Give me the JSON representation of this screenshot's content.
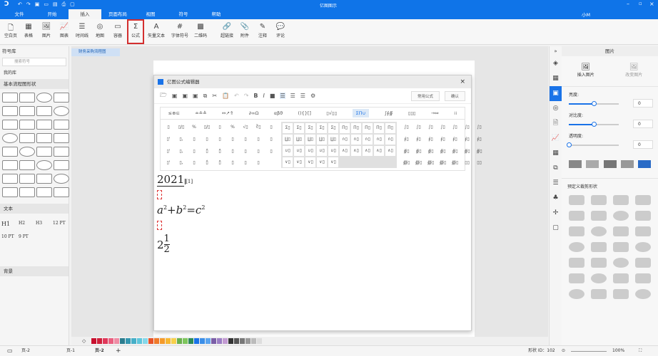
{
  "app": {
    "title": "亿图图示",
    "user": "小M"
  },
  "menu": [
    "文件",
    "开始",
    "插入",
    "页面布局",
    "视图",
    "符号",
    "帮助"
  ],
  "ribbon": [
    {
      "label": "空白页",
      "icon": "🗋"
    },
    {
      "label": "表格",
      "icon": "▦"
    },
    {
      "label": "图片",
      "icon": "🖼"
    },
    {
      "label": "图表",
      "icon": "📈"
    },
    {
      "label": "时间线",
      "icon": "☰"
    },
    {
      "label": "地图",
      "icon": "◎"
    },
    {
      "label": "容器",
      "icon": "▭"
    },
    {
      "label": "公式",
      "icon": "Σ"
    },
    {
      "label": "矢量文本",
      "icon": "A"
    },
    {
      "label": "字体符号",
      "icon": "#"
    },
    {
      "label": "二维码",
      "icon": "▩"
    },
    {
      "label": "超链接",
      "icon": "🔗"
    },
    {
      "label": "附件",
      "icon": "📎"
    },
    {
      "label": "注释",
      "icon": "✎"
    },
    {
      "label": "评论",
      "icon": "💬"
    }
  ],
  "left": {
    "title": "符号库",
    "search_placeholder": "搜索符号",
    "my_lib": "我的库",
    "basic": "基本流程图形状",
    "text_section": "文本",
    "text_items": [
      "H1",
      "H2",
      "H3",
      "12 PT",
      "10 PT",
      "9 PT"
    ],
    "bg_section": "背景"
  },
  "doc_tab": "财务采购流程图",
  "dialog": {
    "title": "亿图公式编辑器",
    "common": "常用公式",
    "confirm": "确认",
    "tabs": [
      "≤⊕⊆",
      "≐≗≙",
      "↔↗⇑",
      "∂∞Ω",
      "αβϑ",
      "(){}[]",
      "▯√▯▯",
      "ΣΠ∪",
      "∫∮∯",
      "▯▯▯",
      "→⇔",
      "⁞⁞"
    ],
    "active_tab": "ΣΠ∪",
    "left_syms": [
      "▯",
      "▯/▯",
      "%",
      "▯/▯",
      "▯",
      "%",
      "√▯",
      "∛▯",
      "▯",
      "▯'",
      "▯,",
      "▯",
      "▯",
      "▯",
      "▯",
      "▯",
      "▯",
      "▯",
      "▯'",
      "▯,",
      "▯",
      "▯̂",
      "▯̆",
      "▯̇",
      "▯",
      "▯",
      "▯",
      "▯'",
      "▯,",
      "▯",
      "▯̂",
      "▯̆",
      "▯̇",
      "▯",
      "▯"
    ],
    "mid_syms": [
      "Σ▯",
      "Σ▯",
      "Σ▯",
      "Σ▯",
      "Σ▯",
      "Π▯",
      "Π▯",
      "Π▯",
      "Π▯",
      "Π▯",
      "∐▯",
      "∐▯",
      "∐▯",
      "∐▯",
      "∐▯",
      "∩▯",
      "∩▯",
      "∩▯",
      "∩▯",
      "∩▯",
      "∪▯",
      "∪▯",
      "∪▯",
      "∪▯",
      "∪▯",
      "∧▯",
      "∧▯",
      "∧▯",
      "∧▯",
      "∧▯",
      "∨▯",
      "∨▯",
      "∨▯",
      "∨▯",
      "∨▯"
    ],
    "right_syms": [
      "∫▯",
      "∫▯",
      "∫▯",
      "∫▯",
      "∫▯",
      "∫▯",
      "∫▯",
      "∮▯",
      "∮▯",
      "∮▯",
      "∮▯",
      "∮▯",
      "∮▯",
      "∮▯",
      "∯▯",
      "∯▯",
      "∯▯",
      "∯▯",
      "∯▯",
      "∯▯",
      "∯▯",
      "∰▯",
      "∰▯",
      "∰▯",
      "∰▯",
      "∰▯",
      "▯▯",
      "▯▯"
    ],
    "formula1": "2021",
    "formula1_sub": "[1]",
    "formula3": {
      "a": "a",
      "b": "b",
      "c": "c",
      "exp": "2"
    },
    "formula5": {
      "whole": "2",
      "num": "1",
      "den": "2"
    }
  },
  "right": {
    "title": "图片",
    "insert": "插入图片",
    "change": "改变图片",
    "brightness": "亮度:",
    "contrast": "对比度:",
    "transparency": "透明度:",
    "brightness_val": "0",
    "contrast_val": "0",
    "transparency_val": "0",
    "brightness_level": 50,
    "contrast_level": 50,
    "transparency_level": 0,
    "crop_title": "预定义裁剪形状"
  },
  "status": {
    "page_select": "页-2",
    "pages": [
      "页-1",
      "页-2"
    ],
    "add": "+",
    "shape_id": "形状 ID：102",
    "zoom": "100%"
  },
  "palette": [
    "#c8102e",
    "#d0213b",
    "#e0385a",
    "#ea6080",
    "#f08da5",
    "#2b7d8f",
    "#3597b0",
    "#46afc8",
    "#5ec6dc",
    "#86d8ea",
    "#e8542a",
    "#f07a2a",
    "#f59a2a",
    "#f7b731",
    "#f8d04b",
    "#6ab04c",
    "#7ec65c",
    "#2e8b57",
    "#1a73e8",
    "#3b8ee8",
    "#5aa4ef",
    "#7b5ea7",
    "#9b7dc4",
    "#c39bd3",
    "#333333",
    "#555555",
    "#777777",
    "#999999",
    "#bbbbbb",
    "#dddddd"
  ]
}
